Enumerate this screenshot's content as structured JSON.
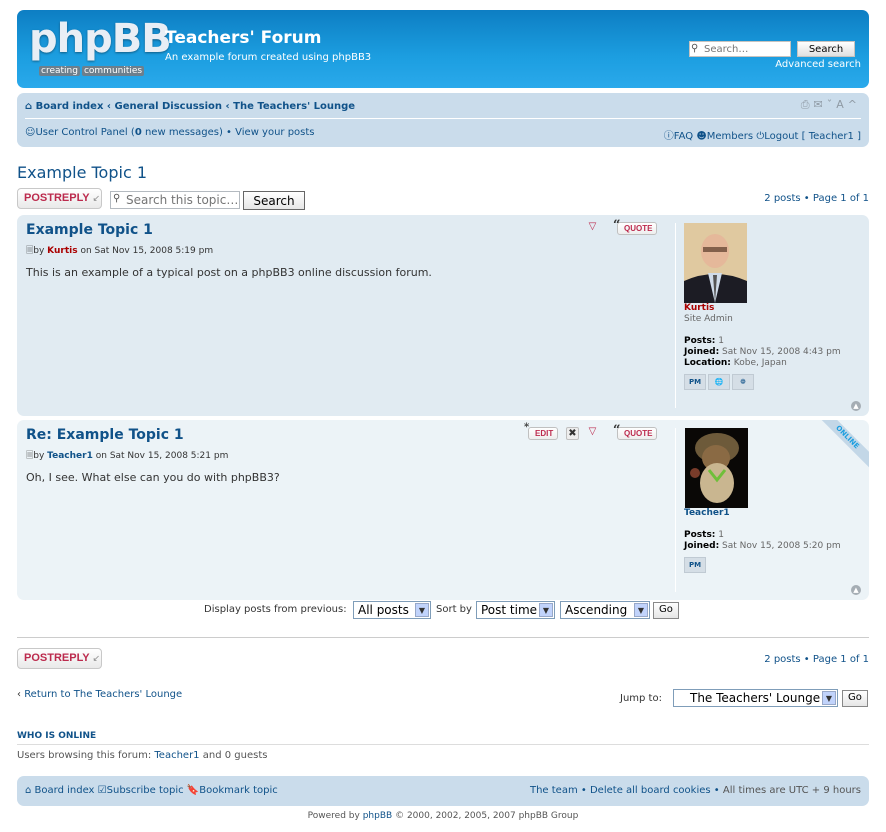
{
  "header": {
    "logo_text": "phpBB",
    "logo_tagline_1": "creating",
    "logo_tagline_2": "communities",
    "site_title": "Teachers' Forum",
    "site_description": "An example forum created using phpBB3",
    "search_placeholder": "Search…",
    "search_button": "Search",
    "advanced_search": "Advanced search"
  },
  "navbar": {
    "breadcrumb": [
      "Board index",
      "General Discussion",
      "The Teachers' Lounge"
    ],
    "breadcrumb_sep": "‹",
    "ucp_label": "User Control Panel",
    "new_messages_count": "0",
    "new_messages_label": "new messages",
    "view_posts": "View your posts",
    "faq": "FAQ",
    "members": "Members",
    "logout": "Logout",
    "username": "Teacher1",
    "font_size_toggle": "A"
  },
  "topic": {
    "title": "Example Topic 1",
    "post_reply_a": "POST",
    "post_reply_b": "REPLY",
    "search_placeholder": "Search this topic…",
    "search_button": "Search",
    "pagination": "2 posts • Page 1 of 1"
  },
  "posts": [
    {
      "title": "Example Topic 1",
      "by": "by",
      "author": "Kurtis",
      "author_color": "#AA0000",
      "date_prefix": "on",
      "date": "Sat Nov 15, 2008 5:19 pm",
      "content": "This is an example of a typical post on a phpBB3 online discussion forum.",
      "buttons": [
        "QUOTE"
      ],
      "rank": "Site Admin",
      "posts_label": "Posts:",
      "posts_count": "1",
      "joined_label": "Joined:",
      "joined": "Sat Nov 15, 2008 4:43 pm",
      "location_label": "Location:",
      "location": "Kobe, Japan",
      "contacts": [
        "PM",
        "WWW",
        "ICQ"
      ],
      "online": false
    },
    {
      "title": "Re: Example Topic 1",
      "by": "by",
      "author": "Teacher1",
      "author_color": "#105289",
      "date_prefix": "on",
      "date": "Sat Nov 15, 2008 5:21 pm",
      "content": "Oh, I see. What else can you do with phpBB3?",
      "buttons": [
        "EDIT",
        "QUOTE"
      ],
      "posts_label": "Posts:",
      "posts_count": "1",
      "joined_label": "Joined:",
      "joined": "Sat Nov 15, 2008 5:20 pm",
      "contacts": [
        "PM"
      ],
      "online": true,
      "online_label": "ONLINE"
    }
  ],
  "sort": {
    "display_label": "Display posts from previous:",
    "display_value": "All posts",
    "sort_label": "Sort by",
    "sort_value": "Post time",
    "direction_value": "Ascending",
    "go": "Go"
  },
  "bottom": {
    "pagination": "2 posts • Page 1 of 1",
    "return_link": "Return to The Teachers' Lounge",
    "jump_label": "Jump to:",
    "jump_value": "The Teachers' Lounge",
    "go": "Go"
  },
  "who_is_online": {
    "heading": "WHO IS ONLINE",
    "text_prefix": "Users browsing this forum:",
    "user": "Teacher1",
    "text_suffix": "and 0 guests"
  },
  "footer": {
    "board_index": "Board index",
    "subscribe": "Subscribe topic",
    "bookmark": "Bookmark topic",
    "team": "The team",
    "delete_cookies": "Delete all board cookies",
    "timezone": "All times are UTC + 9 hours",
    "powered_prefix": "Powered by",
    "powered_link": "phpBB",
    "copyright": "© 2000, 2002, 2005, 2007 phpBB Group"
  },
  "colors": {
    "header_blue": "#12A3EB",
    "link_blue": "#105289",
    "button_red": "#BC2A4D",
    "nav_bg": "#CADCEB",
    "post_bg_1": "#E1EBF2",
    "post_bg_2": "#ECF3F7"
  }
}
